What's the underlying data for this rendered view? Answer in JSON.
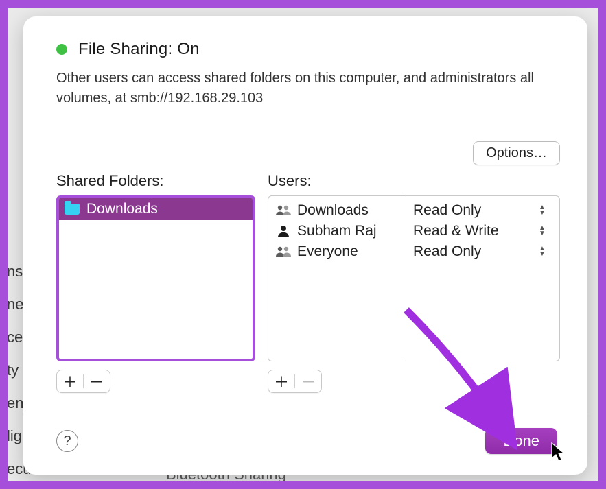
{
  "header": {
    "title": "File Sharing: On",
    "description": "Other users can access shared folders on this computer, and administrators all volumes, at smb://192.168.29.103"
  },
  "options_label": "Options…",
  "shared_folders_label": "Shared Folders:",
  "users_label": "Users:",
  "shared_folders": [
    {
      "name": "Downloads"
    }
  ],
  "users": [
    {
      "name": "Downloads",
      "permission": "Read Only",
      "icon": "group"
    },
    {
      "name": "Subham Raj",
      "permission": "Read & Write",
      "icon": "person"
    },
    {
      "name": "Everyone",
      "permission": "Read Only",
      "icon": "group"
    }
  ],
  "buttons": {
    "done": "Done",
    "help": "?"
  },
  "background_sidebar": [
    "ns",
    "ne",
    "ce",
    "ty",
    "ent",
    "lig",
    "ecurity"
  ],
  "background_footer": "Bluetooth Sharing"
}
